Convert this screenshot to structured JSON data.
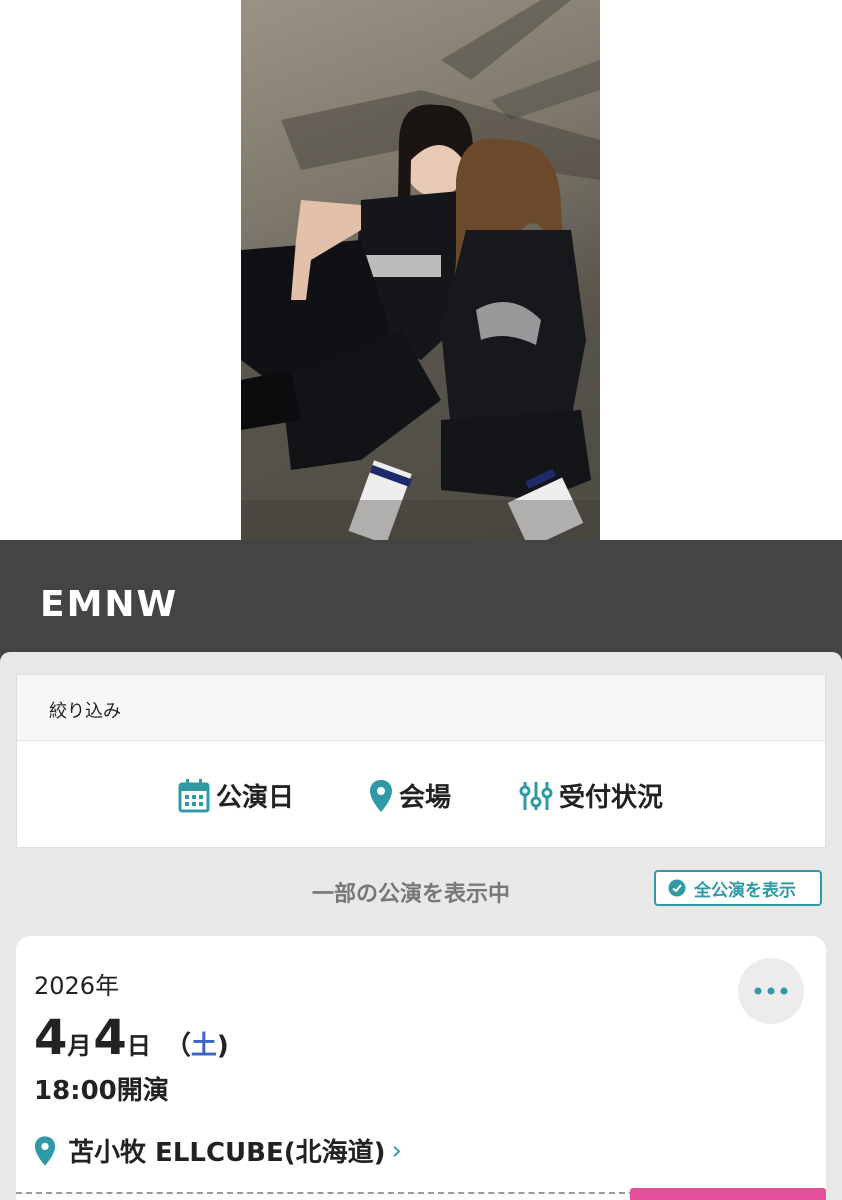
{
  "artist": {
    "name": "EMNW"
  },
  "filter": {
    "heading": "絞り込み",
    "options": [
      {
        "label": "公演日",
        "icon": "calendar-icon"
      },
      {
        "label": "会場",
        "icon": "location-pin-icon"
      },
      {
        "label": "受付状況",
        "icon": "sliders-icon"
      }
    ]
  },
  "listing": {
    "status_text": "一部の公演を表示中",
    "show_all_label": "全公演を表示"
  },
  "event": {
    "year": "2026年",
    "month": "4",
    "month_unit": "月",
    "day": "4",
    "day_unit": "日",
    "weekday_open": "（",
    "weekday": "土",
    "weekday_close": ")",
    "time": "18:00開演",
    "venue": "苫小牧 ELLCUBE(北海道)",
    "venue_chevron": "›"
  },
  "colors": {
    "accent": "#2f9aa6",
    "header_bg": "#444444",
    "weekday_blue": "#3a63c5",
    "pink": "#e4519b"
  }
}
